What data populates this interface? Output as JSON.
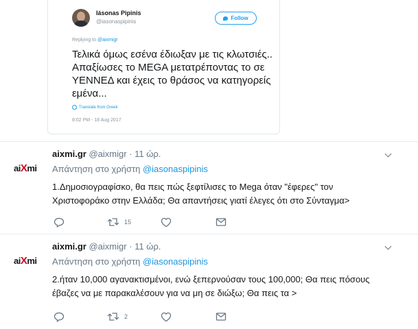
{
  "embed": {
    "name": "Iásonas Pipinis",
    "handle": "@iasonaspipinis",
    "follow_label": "Follow",
    "replying_prefix": "Replying to ",
    "replying_handle": "@aixmigr",
    "text": "Τελικά όμως εσένα έδιωξαν με τις κλωτσιές.. Απαξίωσες το MEGA μετατρέποντας το σε ΥΕΝΝΕΔ και έχεις το θράσος να κατηγορείς εμένα...",
    "translate": "Translate from Greek",
    "timestamp": "8:02 PM - 18 Aug 2017"
  },
  "tweets": [
    {
      "logo_a": "ai",
      "logo_x": "X",
      "logo_b": "mi",
      "name": "aixmi.gr",
      "handle": "@aixmigr",
      "time": " · 11 ώρ.",
      "reply_prefix": "Απάντηση στο χρήστη ",
      "reply_handle": "@iasonaspipinis",
      "text": "1.Δημοσιογραφίσκο, θα πεις πώς ξεφτίλισες το Mega όταν \"έφερες\" τον Χριστοφοράκο στην Ελλάδα; Θα απαντήσεις γιατί έλεγες ότι στο Σύνταγμα>",
      "retweets": "15"
    },
    {
      "logo_a": "ai",
      "logo_x": "X",
      "logo_b": "mi",
      "name": "aixmi.gr",
      "handle": "@aixmigr",
      "time": " · 11 ώρ.",
      "reply_prefix": "Απάντηση στο χρήστη ",
      "reply_handle": "@iasonaspipinis",
      "text": "2.ήταν 10,000 αγανακτισμένοι, ενώ ξεπερνούσαν τους 100,000; Θα πεις πόσους έβαζες να με παρακαλέσουν για να μη σε διώξω; Θα πεις τα >",
      "retweets": "2"
    }
  ],
  "icons": {
    "reply": "reply-icon",
    "retweet": "retweet-icon",
    "like": "heart-icon",
    "dm": "envelope-icon",
    "more": "chevron-down-icon"
  },
  "colors": {
    "link": "#1b95e0",
    "accent": "#1da1f2",
    "logo_x": "#d0021b",
    "muted": "#657786"
  }
}
